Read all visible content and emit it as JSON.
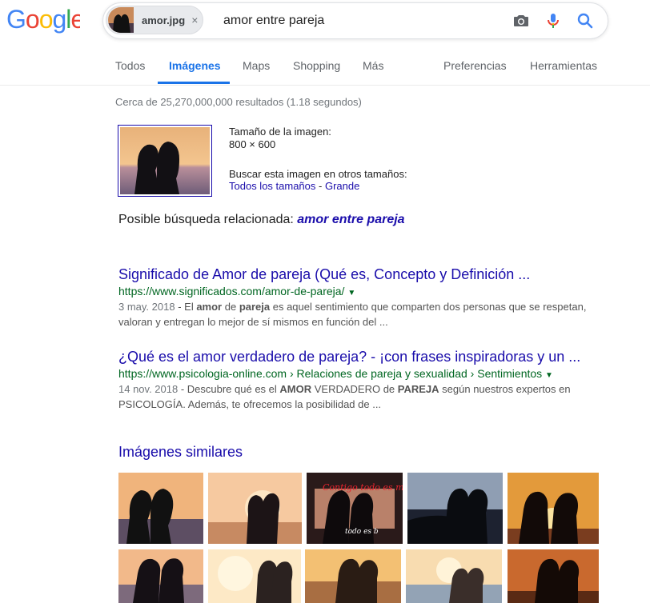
{
  "logo": "Google",
  "search": {
    "chip_label": "amor.jpg",
    "chip_close": "×",
    "query": "amor entre pareja",
    "icons": [
      "camera-icon",
      "microphone-icon",
      "search-icon"
    ]
  },
  "tabs": {
    "items": [
      "Todos",
      "Imágenes",
      "Maps",
      "Shopping",
      "Más"
    ],
    "right": [
      "Preferencias",
      "Herramientas"
    ],
    "active": "Imágenes",
    "accent": "#1a73e8"
  },
  "stats": "Cerca de 25,270,000,000 resultados (1.18 segundos)",
  "image_info": {
    "size_label": "Tamaño de la imagen:",
    "size_value": "800 × 600",
    "other_sizes_label": "Buscar esta imagen en otros tamaños:",
    "all_sizes": "Todos los tamaños",
    "separator": " - ",
    "large": "Grande"
  },
  "related": {
    "label": "Posible búsqueda relacionada:",
    "query": "amor entre pareja"
  },
  "results": [
    {
      "title": "Significado de Amor de pareja (Qué es, Concepto y Definición ...",
      "url": "https://www.significados.com/amor-de-pareja/",
      "date": "3 may. 2018",
      "snippet_line1_pre": " - El ",
      "b1": "amor",
      "mid1": " de ",
      "b2": "pareja",
      "snippet_line1_post": " es aquel sentimiento que comparten dos personas que se respetan,",
      "snippet_line2": "valoran y entregan lo mejor de sí mismos en función del ..."
    },
    {
      "title": "¿Qué es el amor verdadero de pareja? - ¡con frases inspiradoras y un ...",
      "url": "https://www.psicologia-online.com › Relaciones de pareja y sexualidad › Sentimientos",
      "date": "14 nov. 2018",
      "snippet_line1_pre": " - Descubre qué es el ",
      "b1": "AMOR",
      "mid1": " VERDADERO de ",
      "b2": "PAREJA",
      "snippet_line1_post": " según nuestros expertos en",
      "snippet_line2": "PSICOLOGÍA. Además, te ofrecemos la posibilidad de ..."
    }
  ],
  "similar": {
    "heading": "Imágenes similares",
    "overlay_text_top": "Contigo todo es m",
    "overlay_text_bottom": "todo es b"
  }
}
